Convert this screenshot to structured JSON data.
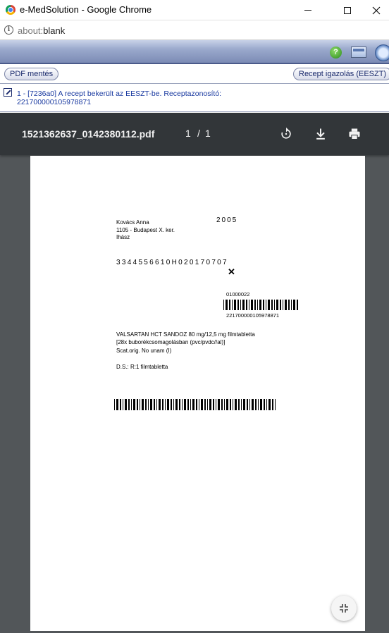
{
  "window": {
    "title": "e-MedSolution - Google Chrome",
    "url_scheme": "about:",
    "url_rest": "blank"
  },
  "toolbar": {
    "pdf_save_label": "PDF mentés",
    "recept_label": "Recept igazolás (EESZT)"
  },
  "message": {
    "text_line1": "1 - [7236a0] A recept bekerült az EESZT-be. Receptazonosító:",
    "text_line2": "221700000105978871"
  },
  "pdf": {
    "filename": "1521362637_0142380112.pdf",
    "page_current": "1",
    "page_separator": "/",
    "page_total": "1"
  },
  "document": {
    "patient_name": "Kovács Anna",
    "address": "1105 - Budapest X. ker.",
    "occupation": "Ihász",
    "year": "2005",
    "code_line": "33445566",
    "code_line_rest": "10H020170707",
    "cross": "✕",
    "small_code": "01000022",
    "barcode1_text": "221700000105978871",
    "drug_line1": "VALSARTAN HCT SANDOZ 80 mg/12,5 mg filmtabletta",
    "drug_line2": "[28x buborékcsomagolásban (pvc/pvdc//al)]",
    "drug_line3": "Scat.orig. No unam (I)",
    "dosage": "D.S.: R:1 filmtabletta"
  },
  "icons": {
    "help": "help-icon",
    "screen": "screen-icon",
    "clock": "clock-icon",
    "rotate": "rotate-icon",
    "download": "download-icon",
    "print": "print-icon",
    "fit": "fit-to-page-icon"
  }
}
